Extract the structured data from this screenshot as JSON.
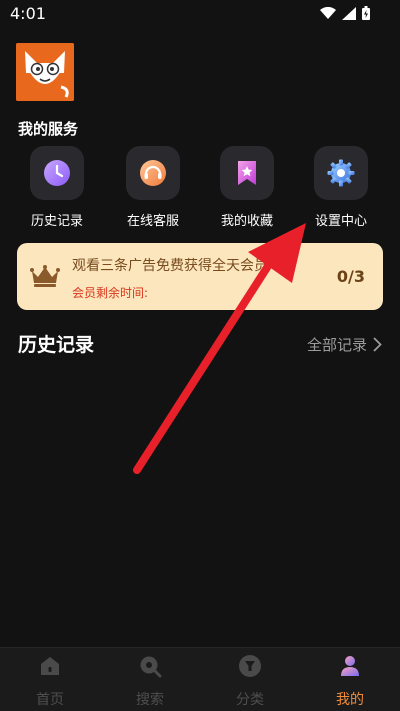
{
  "status_bar": {
    "time": "4:01"
  },
  "services": {
    "title": "我的服务",
    "items": [
      {
        "label": "历史记录",
        "icon": "clock-icon"
      },
      {
        "label": "在线客服",
        "icon": "headset-icon"
      },
      {
        "label": "我的收藏",
        "icon": "bookmark-star-icon"
      },
      {
        "label": "设置中心",
        "icon": "gear-icon"
      }
    ]
  },
  "promo": {
    "title": "观看三条广告免费获得全天会员",
    "subtitle": "会员剩余时间:",
    "count": "0/3"
  },
  "history": {
    "title": "历史记录",
    "all_records": "全部记录"
  },
  "bottom_nav": {
    "items": [
      {
        "label": "首页",
        "icon": "home-icon"
      },
      {
        "label": "搜索",
        "icon": "search-icon"
      },
      {
        "label": "分类",
        "icon": "filter-icon"
      },
      {
        "label": "我的",
        "icon": "profile-icon",
        "active": true
      }
    ]
  },
  "colors": {
    "background": "#121212",
    "promo_bg": "#fbe6be",
    "accent": "#f08c3c",
    "annotation_arrow": "#e8202a"
  }
}
